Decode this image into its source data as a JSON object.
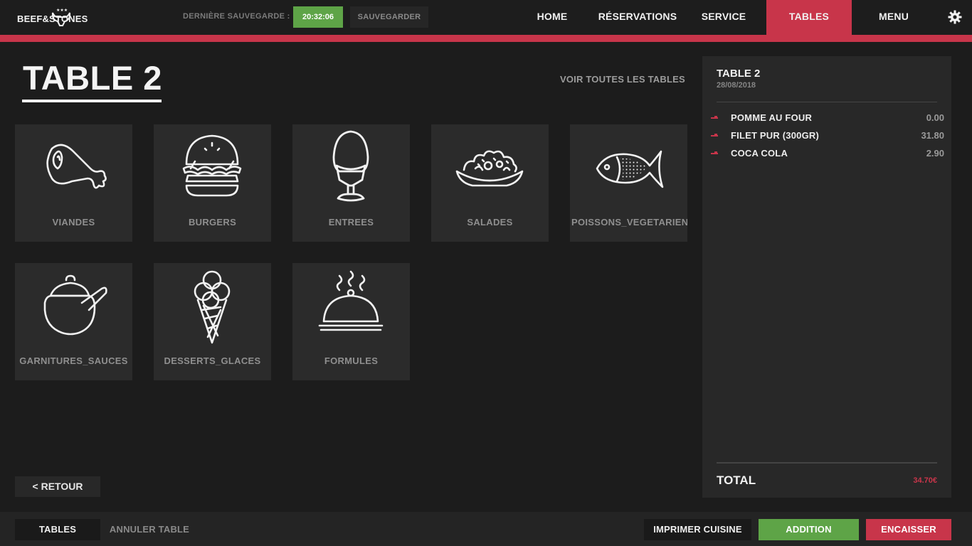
{
  "header": {
    "logo_text": "BEEF&STONES",
    "save_label": "DERNIÈRE SAUVEGARDE :",
    "save_time": "20:32:06",
    "save_button": "SAUVEGARDER",
    "nav": [
      "HOME",
      "RÉSERVATIONS",
      "SERVICE",
      "TABLES",
      "MENU"
    ],
    "active_nav": "TABLES",
    "settings_icon": "gear-icon"
  },
  "main": {
    "title": "TABLE 2",
    "see_all": "VOIR TOUTES LES TABLES",
    "categories": [
      {
        "label": "VIANDES",
        "icon": "ham-icon"
      },
      {
        "label": "BURGERS",
        "icon": "burger-icon"
      },
      {
        "label": "ENTREES",
        "icon": "egg-icon"
      },
      {
        "label": "SALADES",
        "icon": "salad-icon"
      },
      {
        "label": "POISSONS_VEGETARIEN",
        "icon": "fish-icon"
      },
      {
        "label": "GARNITURES_SAUCES",
        "icon": "sauce-pot-icon"
      },
      {
        "label": "DESSERTS_GLACES",
        "icon": "ice-cream-icon"
      },
      {
        "label": "FORMULES",
        "icon": "cloche-icon"
      }
    ],
    "back_button": "< RETOUR"
  },
  "order": {
    "title": "TABLE 2",
    "date": "28/08/2018",
    "items": [
      {
        "name": "POMME AU FOUR",
        "price": "0.00"
      },
      {
        "name": "FILET PUR (300GR)",
        "price": "31.80"
      },
      {
        "name": "COCA COLA",
        "price": "2.90"
      }
    ],
    "total_label": "TOTAL",
    "total_value": "34.70€"
  },
  "footer": {
    "tables": "TABLES",
    "cancel_table": "ANNULER TABLE",
    "print_kitchen": "IMPRIMER CUISINE",
    "addition": "ADDITION",
    "cash_in": "ENCAISSER"
  },
  "colors": {
    "accent": "#c8354a",
    "success": "#5ea447",
    "background": "#1c1c1c",
    "tile": "#2b2b2b"
  }
}
